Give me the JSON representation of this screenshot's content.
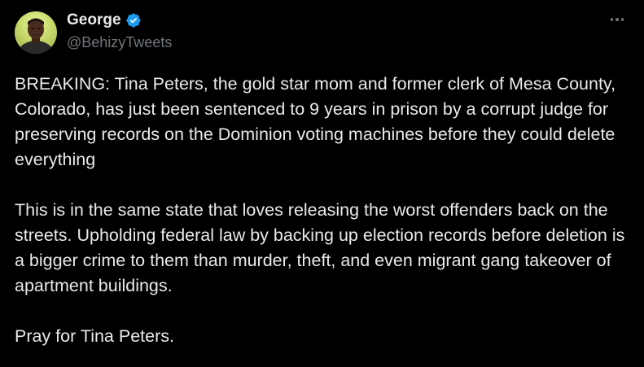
{
  "author": {
    "display_name": "George",
    "handle": "@BehizyTweets",
    "verified": true,
    "verified_color": "#1d9bf0"
  },
  "tweet": {
    "paragraphs": [
      "BREAKING: Tina Peters, the gold star mom and former clerk of Mesa County, Colorado, has just been sentenced to 9 years in prison by a corrupt judge for preserving records on the Dominion voting machines before they could delete everything",
      "This is in the same state that loves releasing the worst offenders back on the streets. Upholding federal law by backing up election records before deletion is a bigger crime to them than murder, theft, and even migrant gang takeover of apartment buildings.",
      "Pray for Tina Peters."
    ]
  },
  "icons": {
    "verified": "verified-badge-icon",
    "more": "more-options-icon"
  },
  "theme": {
    "background": "#000000",
    "text": "#e7e9ea",
    "secondary_text": "#71767b"
  }
}
